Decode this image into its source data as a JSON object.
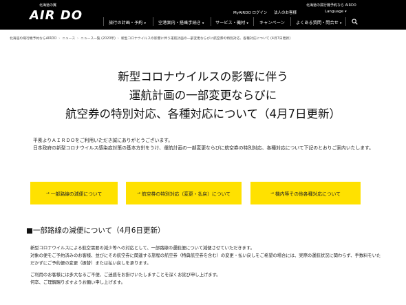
{
  "header": {
    "logo_tagline": "北海道の翼",
    "logo_text": "AIR DO",
    "top_links": [
      "MyAIRDO ログイン",
      "法人のお客様",
      "北海道の飛行機予約なら AIRDO"
    ],
    "language_label": "Language",
    "nav": [
      "旅行の計画・予約",
      "空港案内・搭乗手続き",
      "サービス・機材",
      "キャンペーン",
      "よくある質問・問合せ"
    ]
  },
  "breadcrumb": [
    "北海道の飛行機予約ならAIRDO",
    "ニュース",
    "ニュース一覧 (2020年)",
    "新型コロナウイルスの影響に伴う運航計画の一部変更ならびに航空券の特別対応、各種対応について (4月7日更新)"
  ],
  "title_lines": [
    "新型コロナウイルスの影響に伴う",
    "運航計画の一部変更ならびに",
    "航空券の特別対応、各種対応について（4月7日更新）"
  ],
  "intro": [
    "平素よりＡＩＲＤＯをご利用いただき誠にありがとうございます。",
    "日本政府の新型コロナウイルス感染症対策の基本方針をうけ、運航計画の一部変更ならびに航空券の特別対応、各種対応について下記のとおりご案内いたします。"
  ],
  "buttons": [
    "一部路線の減便について",
    "航空券の特別対応（変更・払戻）について",
    "機内等その他各種対応について"
  ],
  "section": {
    "title": "■一部路線の減便について（4月6日更新）",
    "paragraph1": "新型コロナウイルスによる航空需要の減少等への対応として、一部路線の運航便について減便させていただきます。",
    "paragraph2": "対象の便をご予約済みのお客様、並びにその航空券に関連する旅程の航空券（特典航空券を含む）の変更・払い戻しをご希望の場合には、実際の運航状況に関わらず、手数料をいただかずにご予約便の変更（振替）または払い戻しを承ります。",
    "paragraph3": "ご利用のお客様には多大なるご不便、ご迷惑をお掛けいたしますことを深くお詫び申し上げます。",
    "paragraph4": "何卒、ご理解賜りますようお願い申し上げます。"
  },
  "colors": {
    "header_bg": "#000000",
    "accent_yellow": "#ffe100"
  },
  "icons": {
    "search": "search-icon",
    "arrow": "arrow-right-icon",
    "chevron": "chevron-down-icon"
  }
}
